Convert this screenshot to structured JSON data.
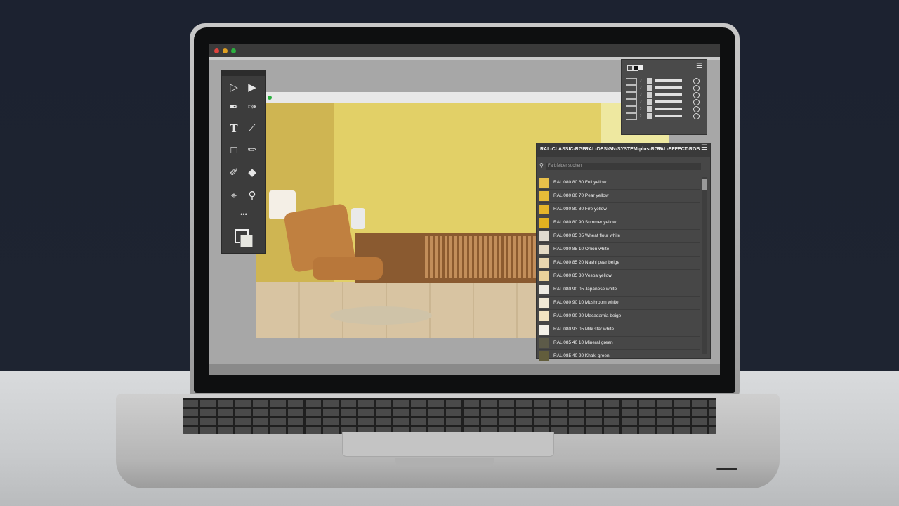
{
  "window": {
    "traffic_lights": [
      "#e0443e",
      "#e0a020",
      "#2bb040"
    ]
  },
  "tools": {
    "items": [
      "selection-tool",
      "direct-selection-tool",
      "pen-tool",
      "add-anchor-tool",
      "type-tool",
      "line-tool",
      "rectangle-tool",
      "brush-tool",
      "shaper-tool",
      "eraser-tool",
      "crop-tool",
      "zoom-tool"
    ],
    "type_glyph": "T",
    "more_glyph": "•••"
  },
  "swatches": {
    "tabs": [
      "RAL-CLASSIC-RGB",
      "RAL-DESIGN-SYSTEM-plus-RGB",
      "RAL-EFFECT-RGB"
    ],
    "search_placeholder": "Farbfelder suchen",
    "items": [
      {
        "name": "RAL 080 80 60 Full yellow",
        "color": "#e8c04a"
      },
      {
        "name": "RAL 080 80 70 Pear yellow",
        "color": "#e6bb38"
      },
      {
        "name": "RAL 080 80 80 Fire yellow",
        "color": "#e4b52a"
      },
      {
        "name": "RAL 080 80 90 Summer yellow",
        "color": "#e2b220"
      },
      {
        "name": "RAL 080 85 05 Wheat flour white",
        "color": "#e0dbd0"
      },
      {
        "name": "RAL 080 85 10 Onion white",
        "color": "#e4dac4"
      },
      {
        "name": "RAL 080 85 20 Nashi pear beige",
        "color": "#e8d6ae"
      },
      {
        "name": "RAL 080 85 30 Vespa yellow",
        "color": "#ead29a"
      },
      {
        "name": "RAL 080 90 05 Japanese white",
        "color": "#eeebe2"
      },
      {
        "name": "RAL 080 90 10 Mushroom white",
        "color": "#f0e8d4"
      },
      {
        "name": "RAL 080 90 20 Macadamia beige",
        "color": "#f2e4c2"
      },
      {
        "name": "RAL 080 93 05 Milk star white",
        "color": "#f4f1e8"
      },
      {
        "name": "RAL 085 40 10 Mineral green",
        "color": "#5c5a48"
      },
      {
        "name": "RAL 085 40 20 Khaki green",
        "color": "#625d3c"
      }
    ]
  }
}
